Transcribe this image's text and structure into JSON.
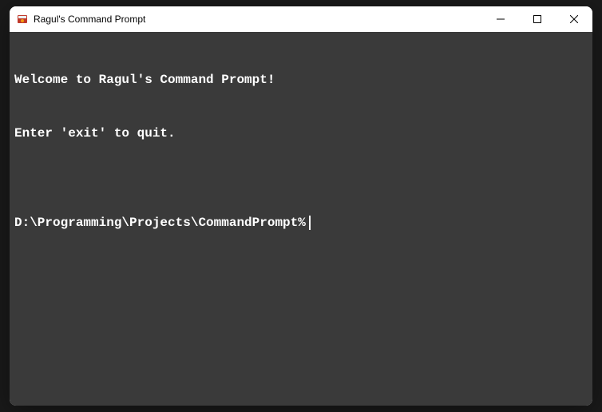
{
  "window": {
    "title": "Ragul's Command Prompt"
  },
  "terminal": {
    "line1": "Welcome to Ragul's Command Prompt!",
    "line2": "Enter 'exit' to quit.",
    "blank": "",
    "prompt": "D:\\Programming\\Projects\\CommandPrompt%"
  }
}
